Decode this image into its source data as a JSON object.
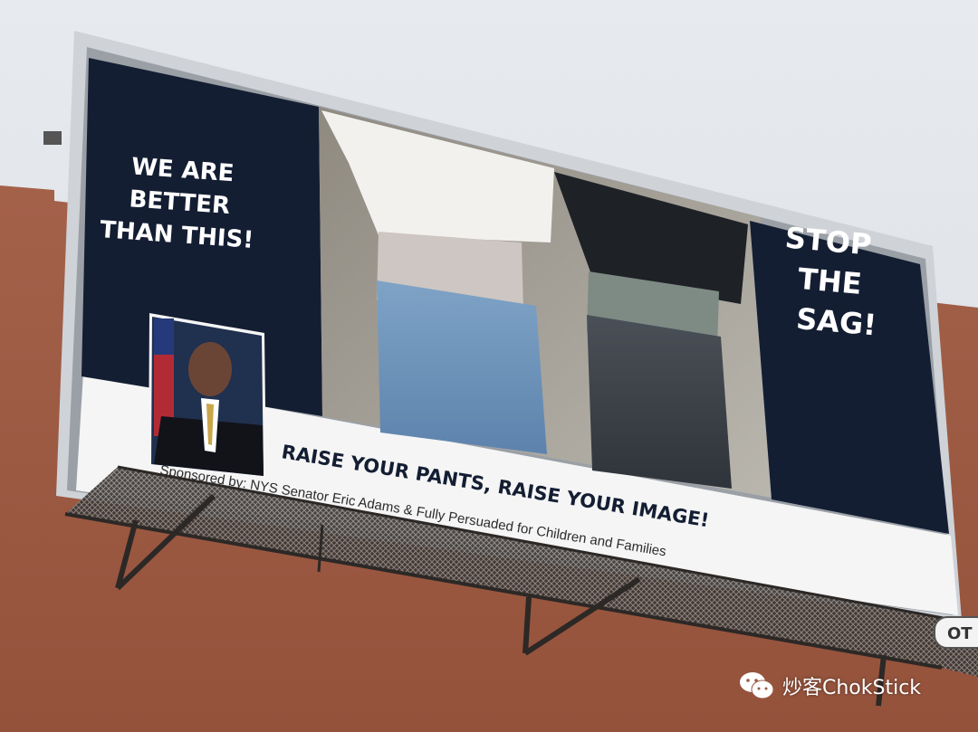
{
  "billboard": {
    "headline_lines": [
      "WE ARE",
      "BETTER",
      "THAN THIS!"
    ],
    "right_lines": [
      "STOP",
      "THE",
      "SAG!"
    ],
    "slogan": "RAISE YOUR PANTS, RAISE YOUR IMAGE!",
    "sponsor_line": "Sponsored by: NYS Senator Eric Adams & Fully Persuaded for Children and Families",
    "corner_tag": "OT"
  },
  "watermark": {
    "icon": "wechat-icon",
    "text": "炒客ChokStick"
  },
  "colors": {
    "sky": "#dfe2e6",
    "wall": "#a05a42",
    "billboard_navy": "#141e33",
    "billboard_white": "#f5f5f5",
    "frame": "#cfd3d8"
  }
}
